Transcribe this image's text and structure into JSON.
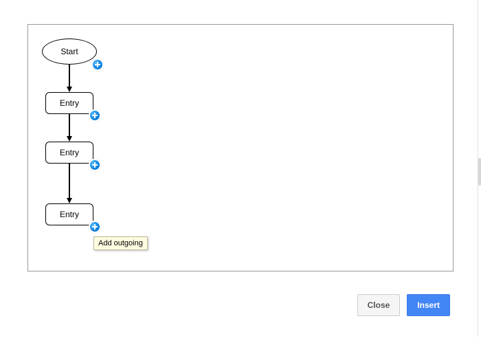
{
  "flow": {
    "start": {
      "label": "Start"
    },
    "entry1": {
      "label": "Entry"
    },
    "entry2": {
      "label": "Entry"
    },
    "entry3": {
      "label": "Entry"
    }
  },
  "tooltip": {
    "add_outgoing": "Add outgoing"
  },
  "footer": {
    "close": "Close",
    "insert": "Insert"
  }
}
